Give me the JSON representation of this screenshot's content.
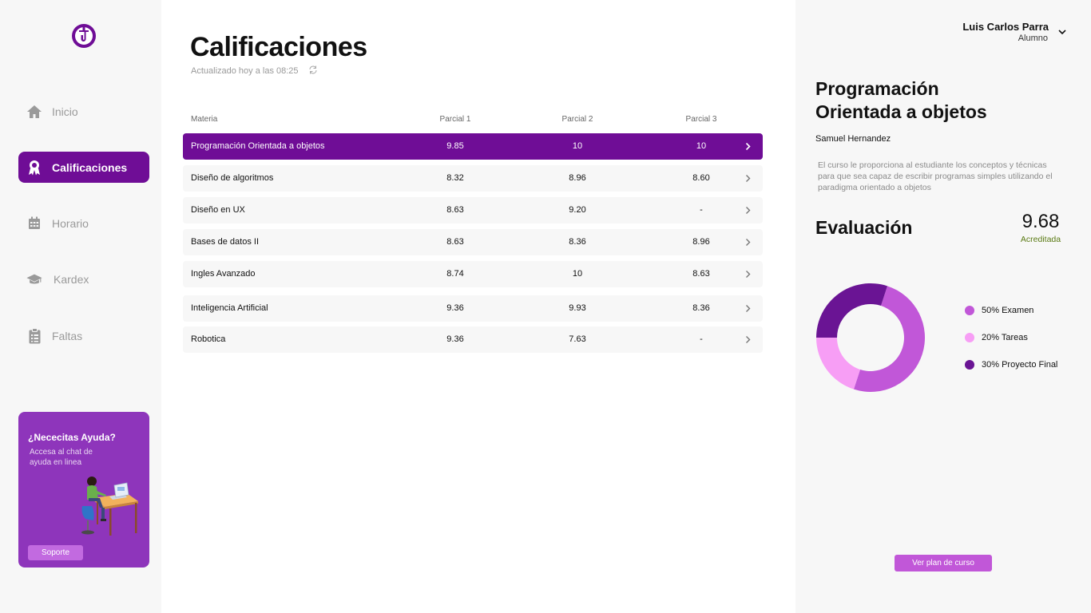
{
  "nav": {
    "items": [
      {
        "label": "Inicio",
        "icon": "home-icon"
      },
      {
        "label": "Calificaciones",
        "icon": "award-icon",
        "active": true
      },
      {
        "label": "Horario",
        "icon": "calendar-icon"
      },
      {
        "label": "Kardex",
        "icon": "graduation-cap-icon"
      },
      {
        "label": "Faltas",
        "icon": "clipboard-icon"
      }
    ]
  },
  "help": {
    "title": "¿Nececitas Ayuda?",
    "subtitle": "Accesa al chat de ayuda en linea",
    "button": "Soporte"
  },
  "main": {
    "title": "Calificaciones",
    "updated": "Actualizado hoy a las 08:25",
    "columns": [
      "Materia",
      "Parcial 1",
      "Parcial 2",
      "Parcial 3"
    ],
    "rows": [
      {
        "name": "Programación Orientada a objetos",
        "p1": "9.85",
        "p2": "10",
        "p3": "10"
      },
      {
        "name": "Diseño de algoritmos",
        "p1": "8.32",
        "p2": "8.96",
        "p3": "8.60"
      },
      {
        "name": "Diseño en UX",
        "p1": "8.63",
        "p2": "9.20",
        "p3": "-"
      },
      {
        "name": "Bases de datos II",
        "p1": "8.63",
        "p2": "8.36",
        "p3": "8.96"
      },
      {
        "name": "Ingles Avanzado",
        "p1": "8.74",
        "p2": "10",
        "p3": "8.63"
      },
      {
        "name": "Inteligencia Artificial",
        "p1": "9.36",
        "p2": "9.93",
        "p3": "8.36"
      },
      {
        "name": "Robotica",
        "p1": "9.36",
        "p2": "7.63",
        "p3": "-"
      }
    ]
  },
  "user": {
    "name": "Luis Carlos Parra",
    "role": "Alumno"
  },
  "course": {
    "title": "Programación Orientada a objetos",
    "teacher": "Samuel Hernandez",
    "description": "El curso le proporciona al estudiante los conceptos y técnicas para que sea capaz de escribir programas simples utilizando el paradigma orientado a objetos",
    "eval_label": "Evaluación",
    "grade": "9.68",
    "grade_status": "Acreditada",
    "plan_button": "Ver plan de curso"
  },
  "chart_data": {
    "type": "pie",
    "categories": [
      "Examen",
      "Tareas",
      "Proyecto Final"
    ],
    "values": [
      50,
      20,
      30
    ],
    "labels": [
      "50% Examen",
      "20% Tareas",
      "30% Proyecto Final"
    ],
    "colors": [
      "#c157d8",
      "#f79ef5",
      "#6a1494"
    ],
    "donut": true
  },
  "colors": {
    "accent": "#6f0d96",
    "help_card": "#8e35bb",
    "status_ok": "#5a7a13"
  }
}
